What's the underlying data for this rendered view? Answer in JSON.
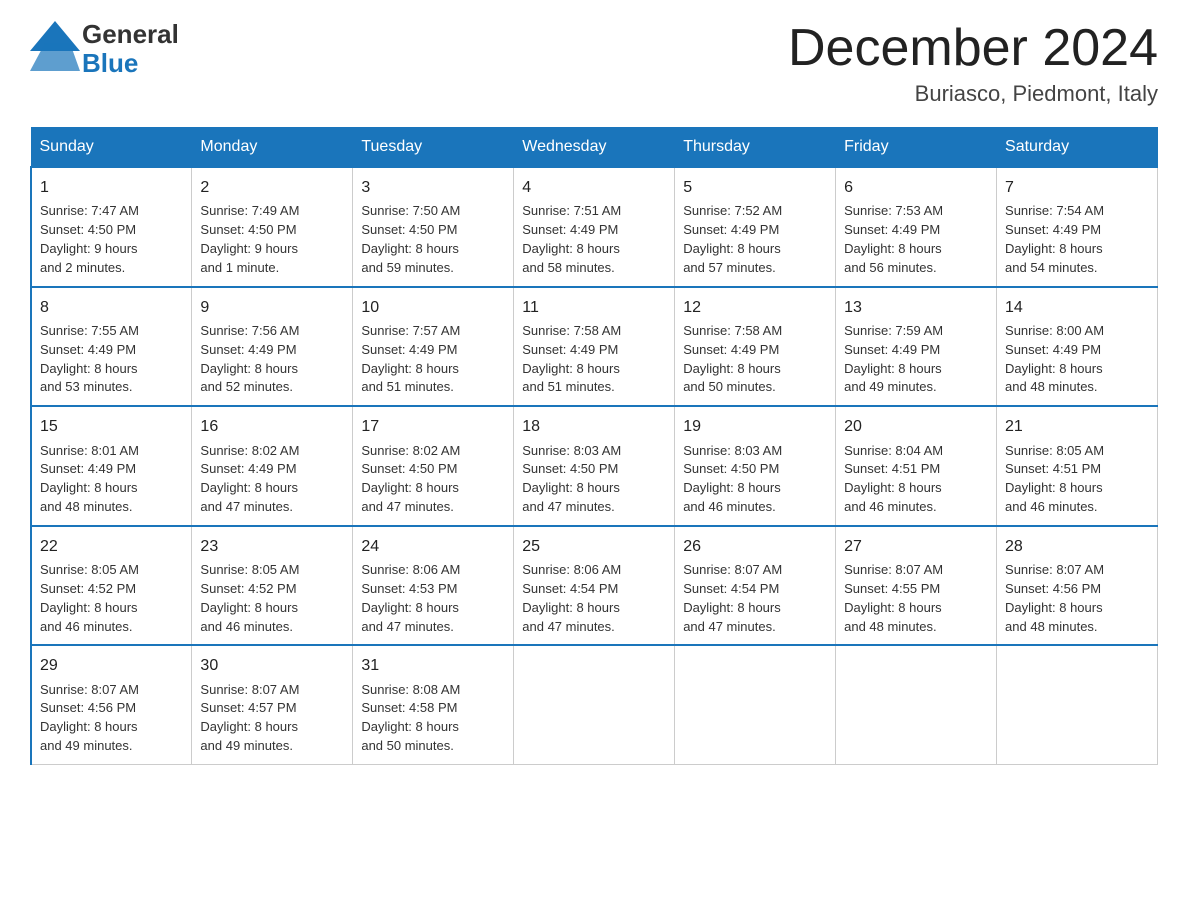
{
  "logo": {
    "general": "General",
    "blue": "Blue"
  },
  "header": {
    "month": "December 2024",
    "location": "Buriasco, Piedmont, Italy"
  },
  "weekdays": [
    "Sunday",
    "Monday",
    "Tuesday",
    "Wednesday",
    "Thursday",
    "Friday",
    "Saturday"
  ],
  "weeks": [
    [
      {
        "day": "1",
        "sunrise": "7:47 AM",
        "sunset": "4:50 PM",
        "daylight": "9 hours and 2 minutes."
      },
      {
        "day": "2",
        "sunrise": "7:49 AM",
        "sunset": "4:50 PM",
        "daylight": "9 hours and 1 minute."
      },
      {
        "day": "3",
        "sunrise": "7:50 AM",
        "sunset": "4:50 PM",
        "daylight": "8 hours and 59 minutes."
      },
      {
        "day": "4",
        "sunrise": "7:51 AM",
        "sunset": "4:49 PM",
        "daylight": "8 hours and 58 minutes."
      },
      {
        "day": "5",
        "sunrise": "7:52 AM",
        "sunset": "4:49 PM",
        "daylight": "8 hours and 57 minutes."
      },
      {
        "day": "6",
        "sunrise": "7:53 AM",
        "sunset": "4:49 PM",
        "daylight": "8 hours and 56 minutes."
      },
      {
        "day": "7",
        "sunrise": "7:54 AM",
        "sunset": "4:49 PM",
        "daylight": "8 hours and 54 minutes."
      }
    ],
    [
      {
        "day": "8",
        "sunrise": "7:55 AM",
        "sunset": "4:49 PM",
        "daylight": "8 hours and 53 minutes."
      },
      {
        "day": "9",
        "sunrise": "7:56 AM",
        "sunset": "4:49 PM",
        "daylight": "8 hours and 52 minutes."
      },
      {
        "day": "10",
        "sunrise": "7:57 AM",
        "sunset": "4:49 PM",
        "daylight": "8 hours and 51 minutes."
      },
      {
        "day": "11",
        "sunrise": "7:58 AM",
        "sunset": "4:49 PM",
        "daylight": "8 hours and 51 minutes."
      },
      {
        "day": "12",
        "sunrise": "7:58 AM",
        "sunset": "4:49 PM",
        "daylight": "8 hours and 50 minutes."
      },
      {
        "day": "13",
        "sunrise": "7:59 AM",
        "sunset": "4:49 PM",
        "daylight": "8 hours and 49 minutes."
      },
      {
        "day": "14",
        "sunrise": "8:00 AM",
        "sunset": "4:49 PM",
        "daylight": "8 hours and 48 minutes."
      }
    ],
    [
      {
        "day": "15",
        "sunrise": "8:01 AM",
        "sunset": "4:49 PM",
        "daylight": "8 hours and 48 minutes."
      },
      {
        "day": "16",
        "sunrise": "8:02 AM",
        "sunset": "4:49 PM",
        "daylight": "8 hours and 47 minutes."
      },
      {
        "day": "17",
        "sunrise": "8:02 AM",
        "sunset": "4:50 PM",
        "daylight": "8 hours and 47 minutes."
      },
      {
        "day": "18",
        "sunrise": "8:03 AM",
        "sunset": "4:50 PM",
        "daylight": "8 hours and 47 minutes."
      },
      {
        "day": "19",
        "sunrise": "8:03 AM",
        "sunset": "4:50 PM",
        "daylight": "8 hours and 46 minutes."
      },
      {
        "day": "20",
        "sunrise": "8:04 AM",
        "sunset": "4:51 PM",
        "daylight": "8 hours and 46 minutes."
      },
      {
        "day": "21",
        "sunrise": "8:05 AM",
        "sunset": "4:51 PM",
        "daylight": "8 hours and 46 minutes."
      }
    ],
    [
      {
        "day": "22",
        "sunrise": "8:05 AM",
        "sunset": "4:52 PM",
        "daylight": "8 hours and 46 minutes."
      },
      {
        "day": "23",
        "sunrise": "8:05 AM",
        "sunset": "4:52 PM",
        "daylight": "8 hours and 46 minutes."
      },
      {
        "day": "24",
        "sunrise": "8:06 AM",
        "sunset": "4:53 PM",
        "daylight": "8 hours and 47 minutes."
      },
      {
        "day": "25",
        "sunrise": "8:06 AM",
        "sunset": "4:54 PM",
        "daylight": "8 hours and 47 minutes."
      },
      {
        "day": "26",
        "sunrise": "8:07 AM",
        "sunset": "4:54 PM",
        "daylight": "8 hours and 47 minutes."
      },
      {
        "day": "27",
        "sunrise": "8:07 AM",
        "sunset": "4:55 PM",
        "daylight": "8 hours and 48 minutes."
      },
      {
        "day": "28",
        "sunrise": "8:07 AM",
        "sunset": "4:56 PM",
        "daylight": "8 hours and 48 minutes."
      }
    ],
    [
      {
        "day": "29",
        "sunrise": "8:07 AM",
        "sunset": "4:56 PM",
        "daylight": "8 hours and 49 minutes."
      },
      {
        "day": "30",
        "sunrise": "8:07 AM",
        "sunset": "4:57 PM",
        "daylight": "8 hours and 49 minutes."
      },
      {
        "day": "31",
        "sunrise": "8:08 AM",
        "sunset": "4:58 PM",
        "daylight": "8 hours and 50 minutes."
      },
      null,
      null,
      null,
      null
    ]
  ]
}
